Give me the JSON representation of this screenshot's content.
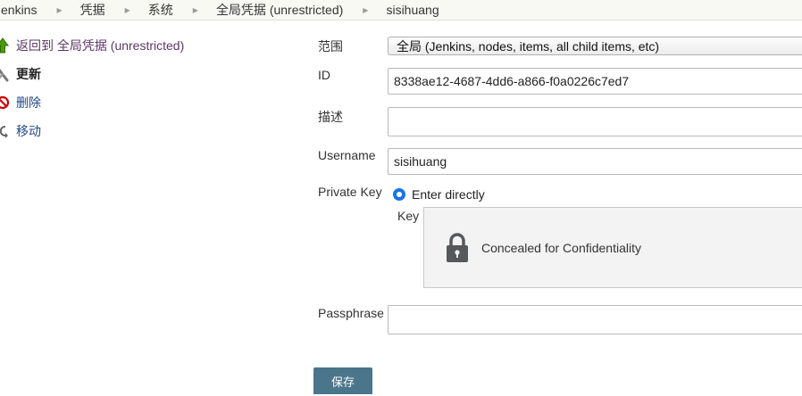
{
  "breadcrumb": {
    "items": [
      "Jenkins",
      "凭据",
      "系统",
      "全局凭据 (unrestricted)",
      "sisihuang"
    ]
  },
  "sidebar": {
    "items": [
      {
        "label": "返回到 全局凭据 (unrestricted)",
        "icon": "up-arrow-icon"
      },
      {
        "label": "更新",
        "icon": "wrench-icon"
      },
      {
        "label": "删除",
        "icon": "no-entry-icon"
      },
      {
        "label": "移动",
        "icon": "move-icon"
      }
    ]
  },
  "form": {
    "scope_label": "范围",
    "scope_value": "全局 (Jenkins, nodes, items, all child items, etc)",
    "id_label": "ID",
    "id_value": "8338ae12-4687-4dd6-a866-f0a0226c7ed7",
    "description_label": "描述",
    "description_value": "",
    "username_label": "Username",
    "username_value": "sisihuang",
    "private_key_label": "Private Key",
    "private_key_option": "Enter directly",
    "key_label": "Key",
    "key_concealed_text": "Concealed for Confidentiality",
    "passphrase_label": "Passphrase",
    "passphrase_value": "",
    "save_label": "保存"
  },
  "colors": {
    "link": "#204a87",
    "visited_link": "#5c3566",
    "button": "#4b758b",
    "radio": "#1a73e8"
  }
}
